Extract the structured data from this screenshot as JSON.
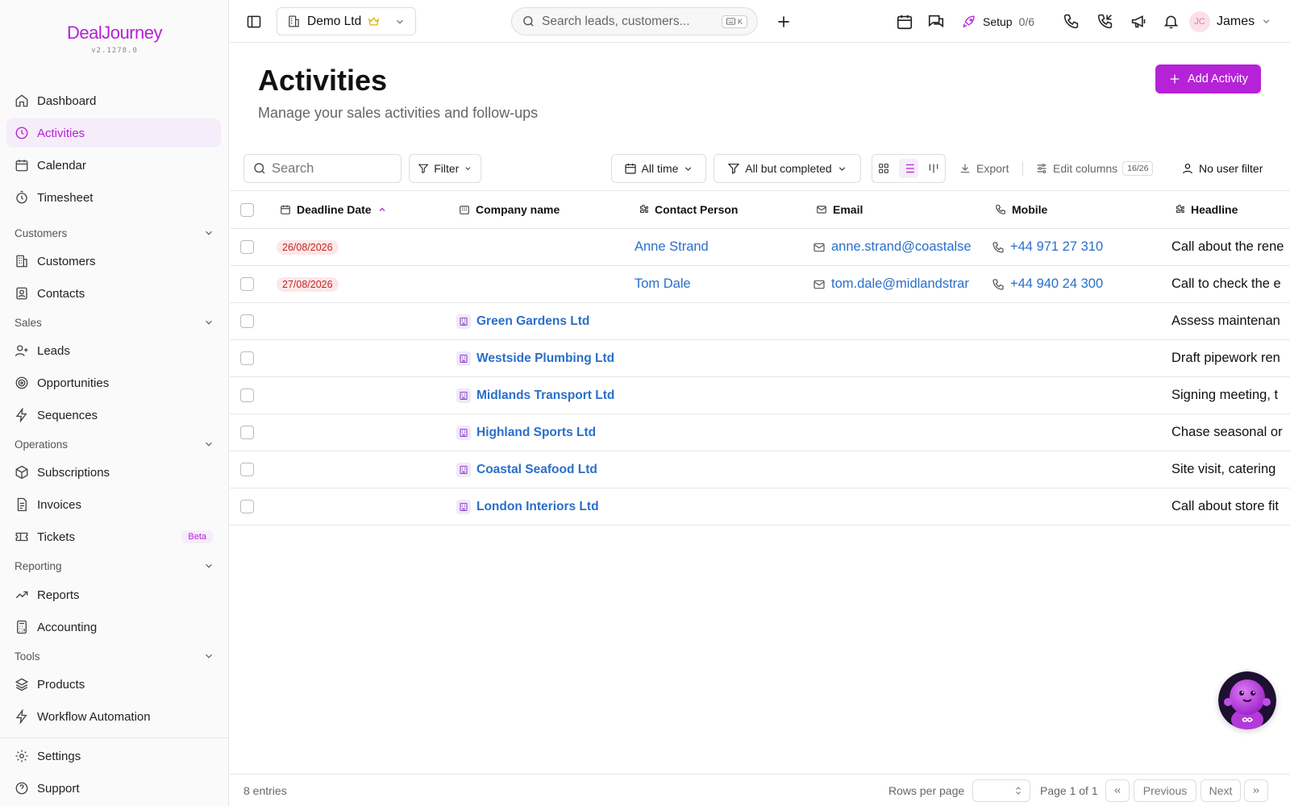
{
  "app": {
    "logo_text": "DealJourney",
    "version": "v2.1278.0"
  },
  "sidebar": {
    "items": [
      {
        "id": "dashboard",
        "label": "Dashboard",
        "icon": "home-icon"
      },
      {
        "id": "activities",
        "label": "Activities",
        "icon": "clock-icon",
        "active": true
      },
      {
        "id": "calendar",
        "label": "Calendar",
        "icon": "calendar-icon"
      },
      {
        "id": "timesheet",
        "label": "Timesheet",
        "icon": "timer-icon"
      },
      {
        "id": "customers",
        "label": "Customers",
        "icon": "building-icon"
      },
      {
        "id": "contacts",
        "label": "Contacts",
        "icon": "contact-book-icon"
      },
      {
        "id": "leads",
        "label": "Leads",
        "icon": "user-plus-icon"
      },
      {
        "id": "opportunities",
        "label": "Opportunities",
        "icon": "target-icon"
      },
      {
        "id": "sequences",
        "label": "Sequences",
        "icon": "lightning-icon"
      },
      {
        "id": "subscriptions",
        "label": "Subscriptions",
        "icon": "box-icon"
      },
      {
        "id": "invoices",
        "label": "Invoices",
        "icon": "document-icon"
      },
      {
        "id": "tickets",
        "label": "Tickets",
        "icon": "ticket-icon",
        "badge": "Beta"
      },
      {
        "id": "reports",
        "label": "Reports",
        "icon": "trend-icon"
      },
      {
        "id": "accounting",
        "label": "Accounting",
        "icon": "calculator-icon"
      },
      {
        "id": "products",
        "label": "Products",
        "icon": "layers-icon"
      },
      {
        "id": "workflow",
        "label": "Workflow Automation",
        "icon": "lightning-icon"
      },
      {
        "id": "settings",
        "label": "Settings",
        "icon": "gear-icon"
      },
      {
        "id": "support",
        "label": "Support",
        "icon": "help-circle-icon"
      }
    ],
    "sections": {
      "customers": "Customers",
      "sales": "Sales",
      "operations": "Operations",
      "reporting": "Reporting",
      "tools": "Tools"
    }
  },
  "topbar": {
    "company": "Demo Ltd",
    "search_placeholder": "Search leads, customers...",
    "search_shortcut": "K",
    "setup_label": "Setup",
    "setup_count": "0/6",
    "user_initials": "JC",
    "user_name": "James"
  },
  "page": {
    "title": "Activities",
    "subtitle": "Manage your sales activities and follow-ups",
    "add_button": "Add Activity"
  },
  "toolbar": {
    "search_placeholder": "Search",
    "filter": "Filter",
    "time_range": "All time",
    "status_filter": "All but completed",
    "export": "Export",
    "edit_columns": "Edit columns",
    "columns_count": "16/26",
    "user_filter": "No user filter"
  },
  "table": {
    "columns": {
      "deadline": "Deadline Date",
      "company": "Company name",
      "contact": "Contact Person",
      "email": "Email",
      "mobile": "Mobile",
      "headline": "Headline"
    },
    "rows": [
      {
        "deadline": "26/08/2026",
        "company": "",
        "contact": "Anne Strand",
        "email": "anne.strand@coastalse",
        "mobile": "+44 971 27 310",
        "headline": "Call about the rene"
      },
      {
        "deadline": "27/08/2026",
        "company": "",
        "contact": "Tom Dale",
        "email": "tom.dale@midlandstrar",
        "mobile": "+44 940 24 300",
        "headline": "Call to check the e"
      },
      {
        "deadline": "",
        "company": "Green Gardens Ltd",
        "contact": "",
        "email": "",
        "mobile": "",
        "headline": "Assess maintenan"
      },
      {
        "deadline": "",
        "company": "Westside Plumbing Ltd",
        "contact": "",
        "email": "",
        "mobile": "",
        "headline": "Draft pipework ren"
      },
      {
        "deadline": "",
        "company": "Midlands Transport Ltd",
        "contact": "",
        "email": "",
        "mobile": "",
        "headline": "Signing meeting, t"
      },
      {
        "deadline": "",
        "company": "Highland Sports Ltd",
        "contact": "",
        "email": "",
        "mobile": "",
        "headline": "Chase seasonal or"
      },
      {
        "deadline": "",
        "company": "Coastal Seafood Ltd",
        "contact": "",
        "email": "",
        "mobile": "",
        "headline": "Site visit, catering"
      },
      {
        "deadline": "",
        "company": "London Interiors Ltd",
        "contact": "",
        "email": "",
        "mobile": "",
        "headline": "Call about store fit"
      }
    ]
  },
  "footer": {
    "entries": "8 entries",
    "rows_per_page": "Rows per page",
    "page_info": "Page 1 of 1",
    "previous": "Previous",
    "next": "Next"
  },
  "colors": {
    "accent": "#b622d8",
    "link": "#2a6fc9",
    "danger": "#c42424"
  }
}
